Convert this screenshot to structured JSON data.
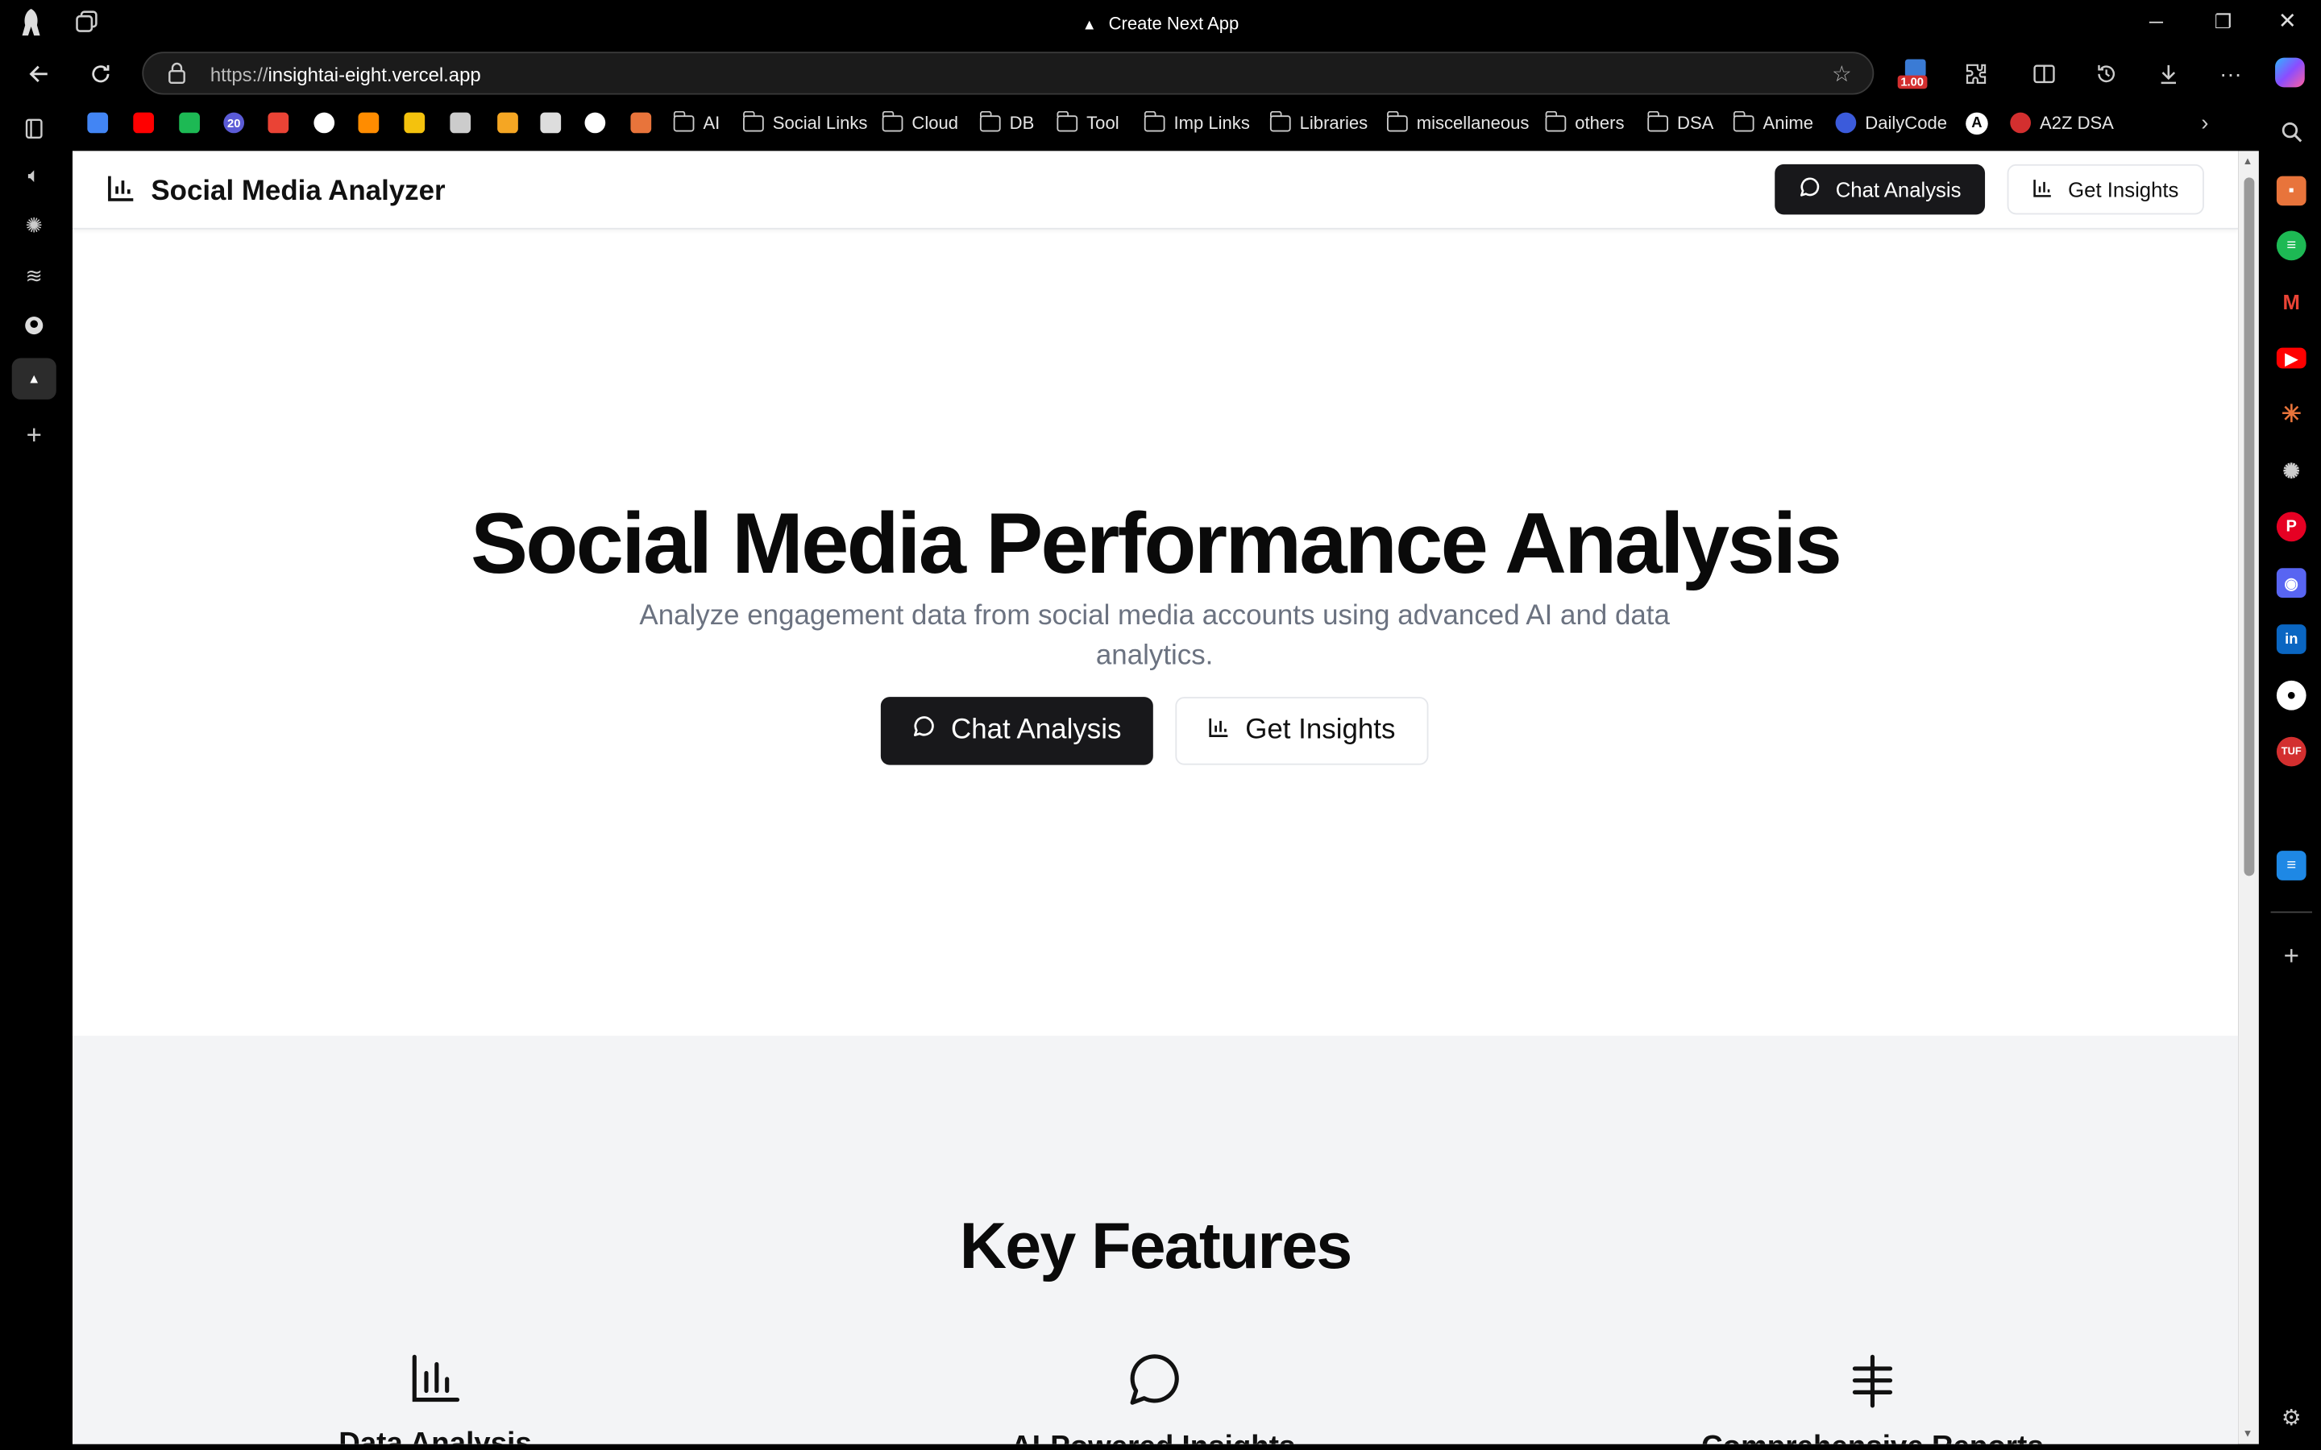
{
  "window": {
    "title": "Create Next App"
  },
  "address_bar": {
    "scheme": "https://",
    "host": "insightai-eight.vercel.app"
  },
  "toolbar": {
    "badge": "1.00"
  },
  "bookmarks": {
    "icon_items": [
      {
        "name": "google",
        "color": "#4285f4"
      },
      {
        "name": "youtube",
        "color": "#ff0000"
      },
      {
        "name": "spotify",
        "color": "#1db954"
      },
      {
        "name": "counter-20",
        "color": "#5b5bd6",
        "text": "20"
      },
      {
        "name": "gmail",
        "color": "#ea4335"
      },
      {
        "name": "github",
        "color": "#ffffff"
      },
      {
        "name": "infinity",
        "color": "#ff8c00"
      },
      {
        "name": "photos",
        "color": "#f4c20d"
      },
      {
        "name": "calendar",
        "color": "#cccccc"
      },
      {
        "name": "lightning",
        "color": "#f5a623"
      },
      {
        "name": "openai",
        "color": "#dddddd"
      },
      {
        "name": "x",
        "color": "#ffffff"
      },
      {
        "name": "claude",
        "color": "#e8743b"
      }
    ],
    "folders": [
      "AI",
      "Social Links",
      "Cloud",
      "DB",
      "Tool",
      "Imp Links",
      "Libraries",
      "miscellaneous",
      "others",
      "DSA",
      "Anime"
    ],
    "links": [
      "DailyCode",
      "A2Z DSA"
    ]
  },
  "site": {
    "brand": "Social Media Analyzer",
    "nav": {
      "chat": "Chat Analysis",
      "insights": "Get Insights"
    },
    "hero": {
      "title": "Social Media Performance Analysis",
      "subtitle": "Analyze engagement data from social media accounts using advanced AI and data analytics.",
      "chat_button": "Chat Analysis",
      "insights_button": "Get Insights"
    },
    "features": {
      "title": "Key Features",
      "items": [
        {
          "icon": "bar-chart-icon",
          "label": "Data Analysis"
        },
        {
          "icon": "chat-bubble-icon",
          "label": "AI-Powered Insights"
        },
        {
          "icon": "hash-icon",
          "label": "Comprehensive Reports"
        }
      ]
    }
  },
  "colors": {
    "primary": "#18181b",
    "muted_text": "#6b7280",
    "features_bg": "#f3f4f6"
  }
}
